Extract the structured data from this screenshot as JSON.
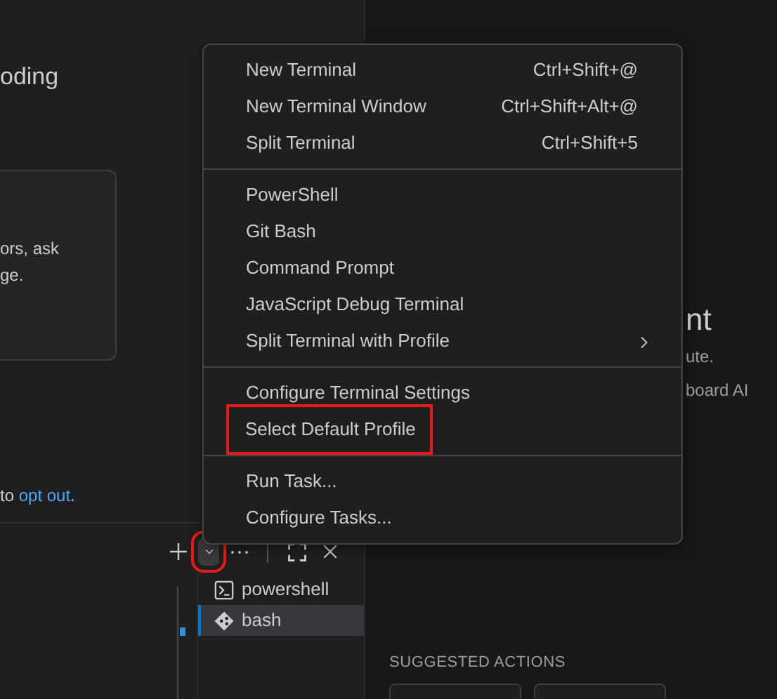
{
  "editor": {
    "heading": "oding",
    "card_lines": [
      "ors, ask",
      "ge."
    ],
    "notice": {
      "before": "to",
      "link": "opt out",
      "after": "."
    }
  },
  "terminal_toolbar": [
    {
      "kind": "add",
      "highlighted": false
    },
    {
      "kind": "dropdown",
      "highlighted": true
    },
    {
      "kind": "more",
      "highlighted": false
    },
    {
      "kind": "maximize",
      "highlighted": false
    },
    {
      "kind": "close",
      "highlighted": false
    }
  ],
  "terminals": [
    {
      "name": "powershell",
      "kind": "powershell",
      "selected": false
    },
    {
      "name": "bash",
      "kind": "git",
      "selected": true
    }
  ],
  "chat_panel": {
    "title": "nt",
    "lines": [
      "ute.",
      "board AI"
    ],
    "section": "SUGGESTED ACTIONS"
  },
  "menu": [
    [
      {
        "label": "New Terminal",
        "shortcut": "Ctrl+Shift+@"
      },
      {
        "label": "New Terminal Window",
        "shortcut": "Ctrl+Shift+Alt+@"
      },
      {
        "label": "Split Terminal",
        "shortcut": "Ctrl+Shift+5"
      }
    ],
    [
      {
        "label": "PowerShell"
      },
      {
        "label": "Git Bash"
      },
      {
        "label": "Command Prompt"
      },
      {
        "label": "JavaScript Debug Terminal"
      },
      {
        "label": "Split Terminal with Profile",
        "submenu": true
      }
    ],
    [
      {
        "label": "Configure Terminal Settings"
      },
      {
        "label": "Select Default Profile",
        "highlighted": true
      }
    ],
    [
      {
        "label": "Run Task..."
      },
      {
        "label": "Configure Tasks..."
      }
    ]
  ]
}
